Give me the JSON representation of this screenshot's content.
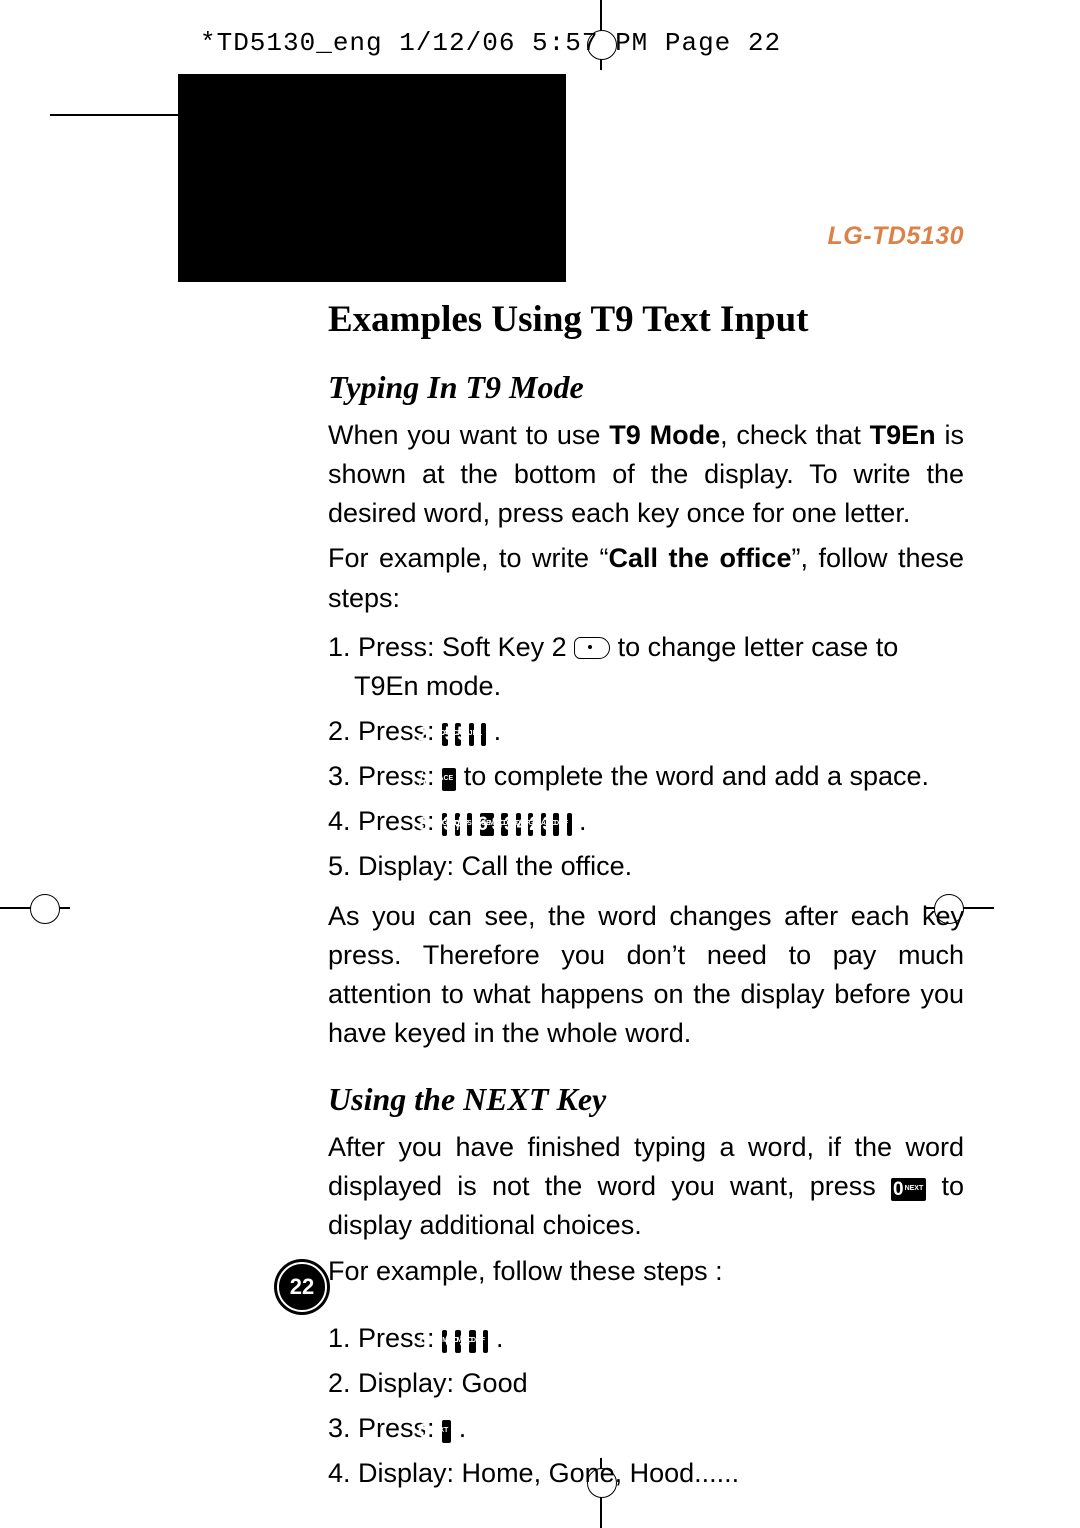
{
  "header": "*TD5130_eng  1/12/06  5:57 PM  Page 22",
  "model": "LG-TD5130",
  "page_number": "22",
  "section_title": "Examples Using T9 Text Input",
  "sub1": {
    "title": "Typing In T9 Mode",
    "p1_pre": "When you want to use ",
    "p1_b1": "T9 Mode",
    "p1_mid": ", check that ",
    "p1_b2": "T9En",
    "p1_post": " is shown at the bottom of the display. To write the desired word, press each key once for one letter.",
    "p2_pre": "For example, to write “",
    "p2_b": "Call the office",
    "p2_post": "”, follow these steps:",
    "s1_a": "1. Press: Soft Key 2 ",
    "s1_b": " to change letter case to T9En mode.",
    "s2": "2. Press: ",
    "s3_a": "3. Press: ",
    "s3_b": " to complete the word and add a space.",
    "s4": "4. Press: ",
    "s5": "5. Display: Call the office.",
    "p3": "As you can see, the word changes after each key press. Therefore you don’t need to pay much attention to what happens on the display before you have keyed in the whole word."
  },
  "sub2": {
    "title": "Using the NEXT Key",
    "p1_a": "After you have finished typing a word, if the word displayed is not the word you want, press ",
    "p1_b": " to display additional choices.",
    "p2": "For example, follow these steps :",
    "s1": "1. Press: ",
    "s2": "2. Display: Good",
    "s3": "3. Press: ",
    "s4": "4. Display: Home, Gone, Hood......"
  },
  "keys": {
    "k2": {
      "d": "2",
      "l": "ABC"
    },
    "k3": {
      "d": "3",
      "l": "DEF"
    },
    "k4": {
      "d": "4",
      "l": "GHI"
    },
    "k5": {
      "d": "5",
      "l": "JKL"
    },
    "k6": {
      "d": "6",
      "l": "MNO"
    },
    "k8": {
      "d": "8",
      "l": "TUV"
    },
    "kh": {
      "d": "#",
      "l": "SPACE"
    },
    "k0": {
      "d": "0",
      "l": "NEXT"
    }
  }
}
